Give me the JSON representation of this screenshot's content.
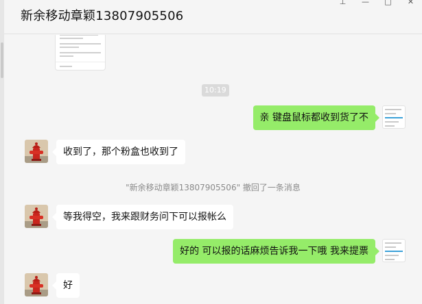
{
  "window": {
    "title": "新余移动章颖13807905506",
    "controls": [
      {
        "name": "pin-icon",
        "glyph": "⊥"
      },
      {
        "name": "minimize-icon",
        "glyph": "—"
      },
      {
        "name": "maximize-icon",
        "glyph": "□"
      },
      {
        "name": "close-icon",
        "glyph": "✕"
      }
    ]
  },
  "chat": {
    "time_divider": "10:19",
    "messages": [
      {
        "from": "me",
        "text": "亲 键盘鼠标都收到货了不"
      },
      {
        "from": "contact",
        "text": "收到了，那个粉盒也收到了"
      },
      {
        "from": "contact",
        "text": "等我得空，我来跟财务问下可以报帐么"
      },
      {
        "from": "me",
        "text": "好的 可以报的话麻烦告诉我一下哦 我来提票"
      },
      {
        "from": "contact",
        "text": "好"
      }
    ],
    "recall_notice": "\"新余移动章颖13807905506\" 撤回了一条消息"
  },
  "colors": {
    "outgoing_bubble": "#95ec69",
    "incoming_bubble": "#ffffff",
    "background": "#f5f5f5"
  }
}
